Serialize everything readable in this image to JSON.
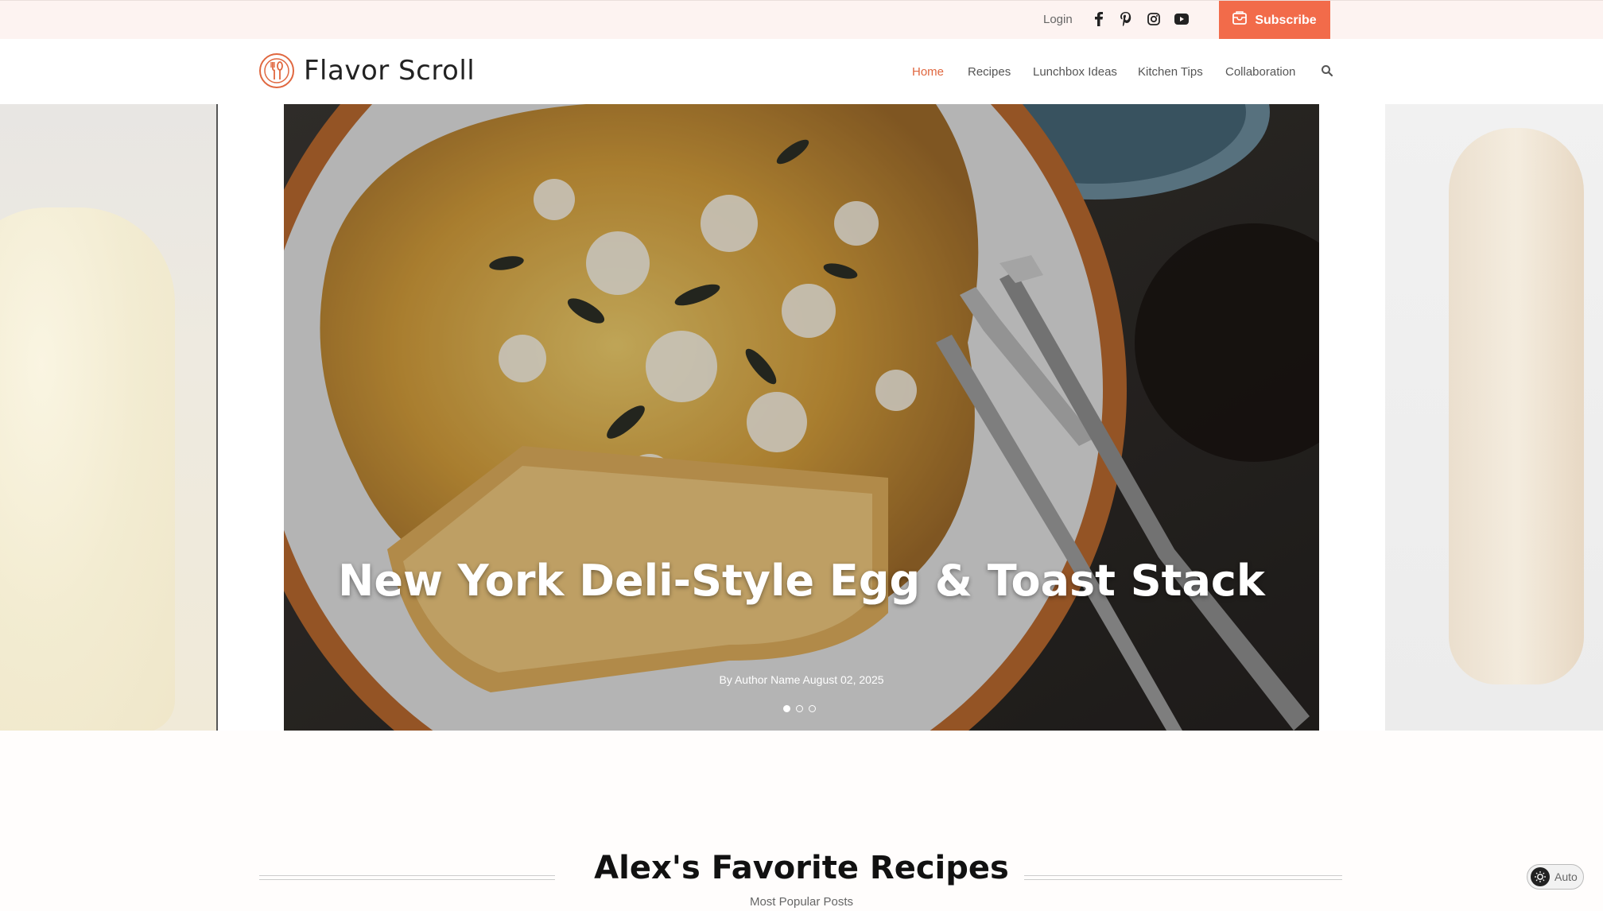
{
  "topbar": {
    "login": "Login",
    "social": [
      "facebook-icon",
      "pinterest-icon",
      "instagram-icon",
      "youtube-icon"
    ],
    "subscribe": "Subscribe"
  },
  "header": {
    "site_title": "Flavor Scroll",
    "nav": [
      "Home",
      "Recipes",
      "Lunchbox Ideas",
      "Kitchen Tips",
      "Collaboration"
    ],
    "active_nav": "Home"
  },
  "hero": {
    "title": "New York Deli-Style Egg & Toast Stack",
    "meta": "By Author Name August 02, 2025",
    "slides": 3,
    "active_slide": 1
  },
  "section": {
    "title": "Alex's Favorite Recipes",
    "subtitle": "Most Popular Posts"
  },
  "theme_toggle": {
    "label": "Auto"
  },
  "colors": {
    "accent": "#f26b4a",
    "topbar_bg": "#fdf3f1",
    "active_nav": "#e0673f"
  }
}
